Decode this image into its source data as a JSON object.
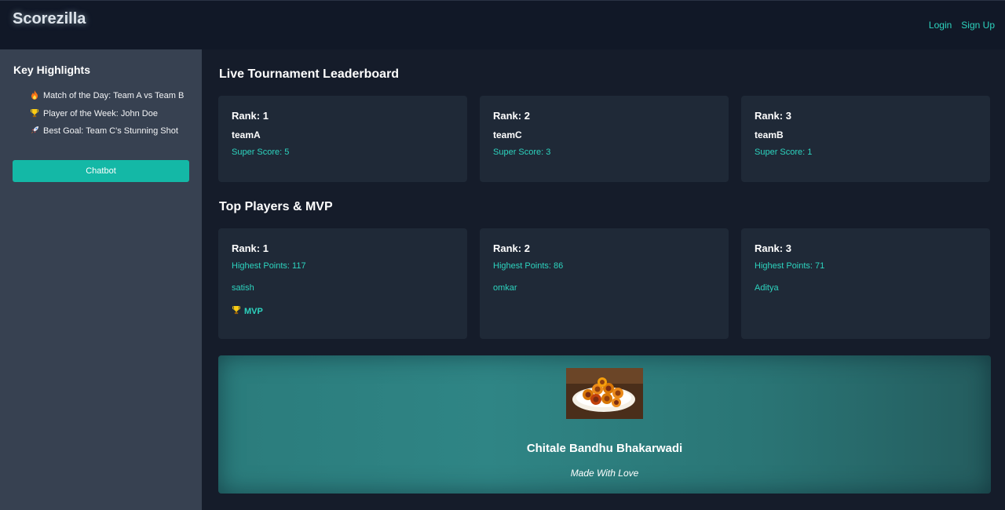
{
  "header": {
    "brand": "Scorezilla",
    "nav": [
      {
        "label": "Login"
      },
      {
        "label": "Sign Up"
      }
    ]
  },
  "sidebar": {
    "title": "Key Highlights",
    "items": [
      {
        "icon": "fire-icon",
        "text": "Match of the Day: Team A vs Team B"
      },
      {
        "icon": "trophy-icon",
        "text": "Player of the Week: John Doe"
      },
      {
        "icon": "rocket-icon",
        "text": "Best Goal: Team C's Stunning Shot"
      }
    ],
    "chatbot_label": "Chatbot"
  },
  "leaderboard": {
    "title": "Live Tournament Leaderboard",
    "teams": [
      {
        "rank": "Rank: 1",
        "team": "teamA",
        "score": "Super Score: 5"
      },
      {
        "rank": "Rank: 2",
        "team": "teamC",
        "score": "Super Score: 3"
      },
      {
        "rank": "Rank: 3",
        "team": "teamB",
        "score": "Super Score: 1"
      }
    ]
  },
  "players": {
    "title": "Top Players & MVP",
    "items": [
      {
        "rank": "Rank: 1",
        "points": "Highest Points: 117",
        "name": "satish",
        "badge": "MVP"
      },
      {
        "rank": "Rank: 2",
        "points": "Highest Points: 86",
        "name": "omkar"
      },
      {
        "rank": "Rank: 3",
        "points": "Highest Points: 71",
        "name": "Aditya"
      }
    ]
  },
  "sponsor": {
    "title": "Chitale Bandhu Bhakarwadi",
    "subtitle": "Made With Love"
  },
  "colors": {
    "accent": "#2dd4bf",
    "button": "#14b8a6",
    "card": "#1f2937",
    "sidebar": "#374151"
  }
}
